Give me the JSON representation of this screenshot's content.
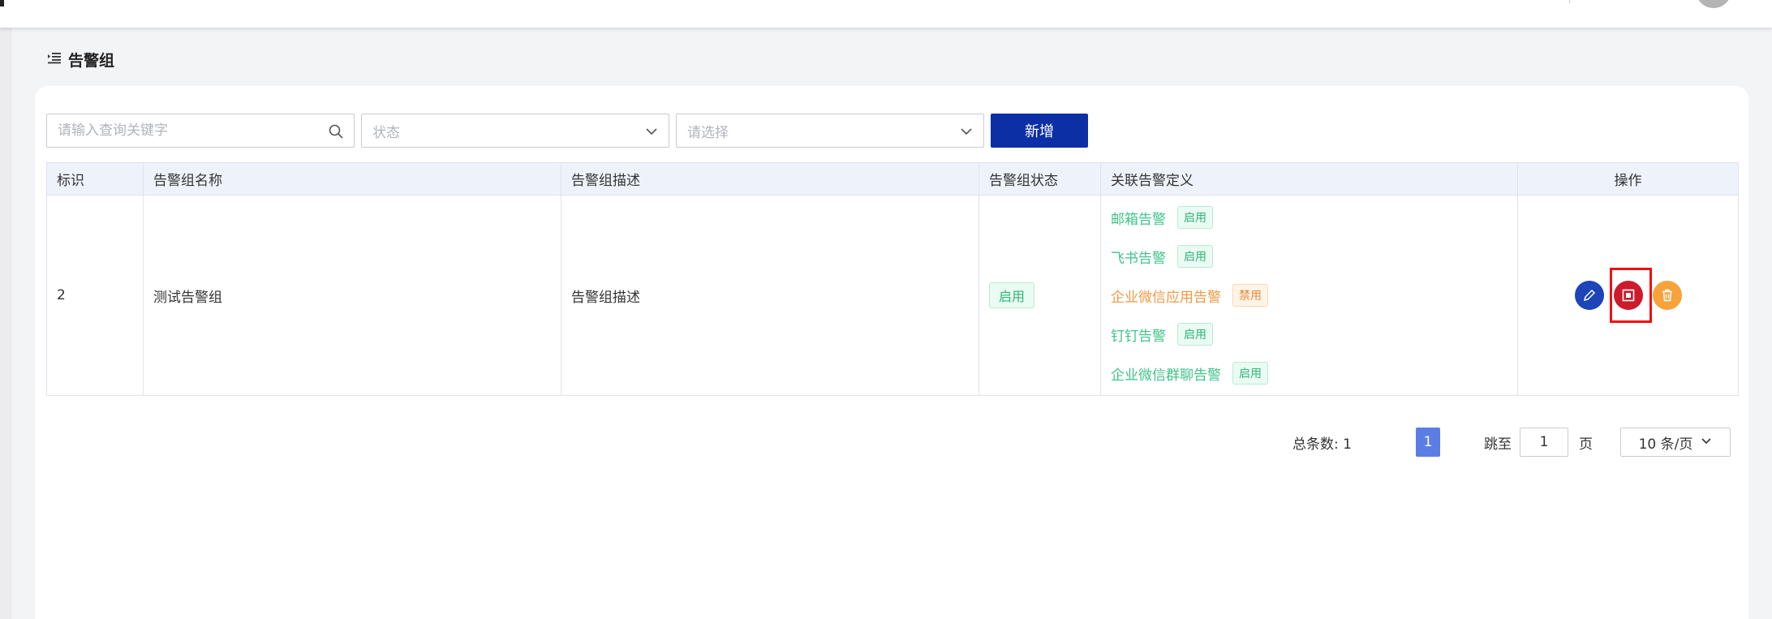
{
  "page": {
    "title": "告警组"
  },
  "toolbar": {
    "search_placeholder": "请输入查询关键字",
    "status_placeholder": "状态",
    "select_placeholder": "请选择",
    "add_label": "新增"
  },
  "table": {
    "columns": [
      "标识",
      "告警组名称",
      "告警组描述",
      "告警组状态",
      "关联告警定义",
      "操作"
    ],
    "rows": [
      {
        "id": "2",
        "name": "测试告警组",
        "description": "告警组描述",
        "status": "启用",
        "alerts": [
          {
            "name": "邮箱告警",
            "status": "启用",
            "enabled": true
          },
          {
            "name": "飞书告警",
            "status": "启用",
            "enabled": true
          },
          {
            "name": "企业微信应用告警",
            "status": "禁用",
            "enabled": false
          },
          {
            "name": "钉钉告警",
            "status": "启用",
            "enabled": true
          },
          {
            "name": "企业微信群聊告警",
            "status": "启用",
            "enabled": true
          }
        ]
      }
    ]
  },
  "pagination": {
    "total_label": "总条数: 1",
    "current_page": "1",
    "jump_label": "跳至",
    "jump_value": "1",
    "page_suffix": "页",
    "page_size_label": "10 条/页"
  },
  "icons": {
    "menu": "menu-indent-icon",
    "search": "search-icon",
    "dropdown": "chevron-down-icon",
    "edit": "pencil-icon",
    "stop": "stop-square-icon",
    "delete": "trash-icon"
  },
  "colors": {
    "primary": "#0d2fa6",
    "enabled": "#2fb57a",
    "disabled": "#e8893a",
    "edit_button": "#1d44b8",
    "stop_button": "#cc1b2a",
    "delete_button": "#f7a23b",
    "highlight": "#f01010",
    "active_page": "#5b7ee6"
  }
}
